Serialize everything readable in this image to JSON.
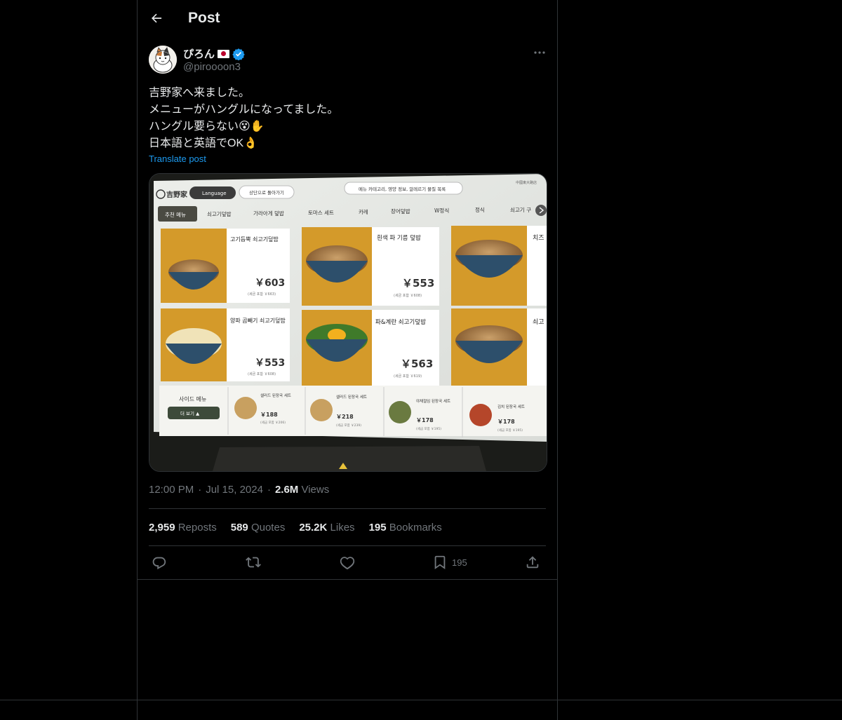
{
  "header": {
    "title": "Post"
  },
  "author": {
    "display_name": "ぴろん",
    "handle": "@piroooon3",
    "flag": "🇯🇵"
  },
  "post": {
    "lines": [
      "吉野家へ来ました。",
      "メニューがハングルになってました。",
      "ハングル要らない😵✋",
      "日本語と英語でOK👌"
    ],
    "translate_label": "Translate post"
  },
  "menu_photo": {
    "logo": "吉野家",
    "language_btn": "Language",
    "back_btn": "상단으로 돌아가기",
    "info_btn": "메뉴 카테고리, 영양 정보, 알레르기 물질 목록",
    "corner": "中國東大路店",
    "tabs": [
      "추천 메뉴",
      "쇠고기덮밥",
      "가라아게 덮밥",
      "토마스 세트",
      "카레",
      "장어덮밥",
      "W정식",
      "정식",
      "쇠고기 구"
    ],
    "items": [
      {
        "name": "고기듬뿍 쇠고기덮밥",
        "price": "￥603",
        "tax": "(세금 포함 ￥663)"
      },
      {
        "name": "흰색 파 기름 덮밥",
        "price": "￥553",
        "tax": "(세금 포함 ￥608)"
      },
      {
        "name": "치즈",
        "price": "",
        "tax": ""
      },
      {
        "name": "양파 곱빼기 쇠고기덮밥",
        "price": "￥553",
        "tax": "(세금 포함 ￥608)"
      },
      {
        "name": "파&계란 쇠고기덮밥",
        "price": "￥563",
        "tax": "(세금 포함 ￥619)"
      },
      {
        "name": "쇠고",
        "price": "",
        "tax": ""
      }
    ],
    "side_label": "사이드 메뉴",
    "more_btn": "더 보기 ▲",
    "sides": [
      {
        "name": "샐러드 된장국 세트",
        "price": "￥188",
        "tax": "(세금 포함 ￥206)"
      },
      {
        "name": "샐러드 된장국 세트",
        "price": "￥218",
        "tax": "(세금 포함 ￥239)"
      },
      {
        "name": "야채절임 된장국 세트",
        "price": "￥178",
        "tax": "(세금 포함 ￥195)"
      },
      {
        "name": "김치 된장국 세트",
        "price": "￥178",
        "tax": "(세금 포함 ￥195)"
      }
    ]
  },
  "meta": {
    "time": "12:00 PM",
    "date": "Jul 15, 2024",
    "views_count": "2.6M",
    "views_label": "Views"
  },
  "stats": {
    "reposts_count": "2,959",
    "reposts_label": "Reposts",
    "quotes_count": "589",
    "quotes_label": "Quotes",
    "likes_count": "25.2K",
    "likes_label": "Likes",
    "bookmarks_count": "195",
    "bookmarks_label": "Bookmarks"
  },
  "actions": {
    "bookmark_count": "195"
  },
  "colors": {
    "accent": "#1d9bf0",
    "muted": "#71767b",
    "text": "#e7e9ea",
    "border": "#2f3336"
  }
}
